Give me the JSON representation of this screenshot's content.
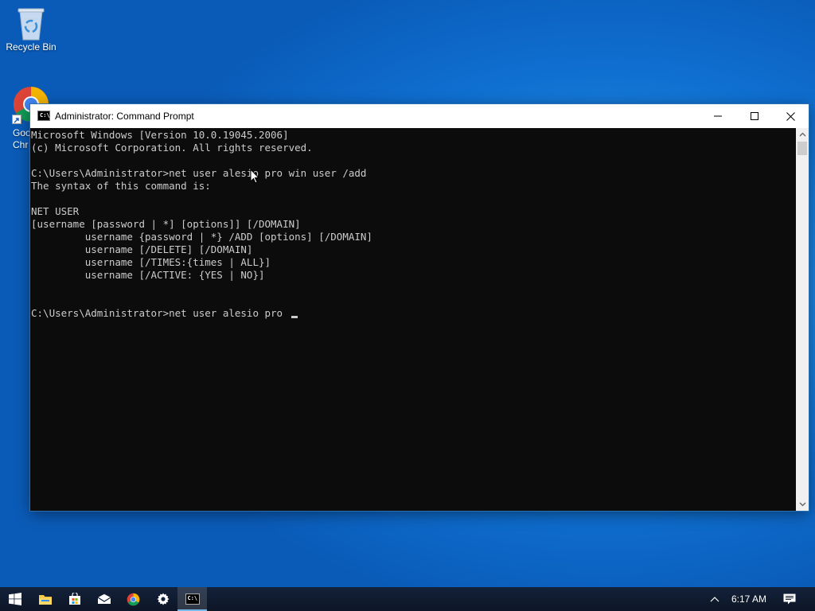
{
  "desktop": {
    "icons": [
      {
        "label": "Recycle Bin",
        "icon": "recycle-bin-icon"
      },
      {
        "label": "Goo\nChr",
        "icon": "chrome-shortcut-icon"
      }
    ]
  },
  "window": {
    "title": "Administrator: Command Prompt",
    "icon": "cmd-icon",
    "icon_text": "C:\\",
    "controls": [
      "minimize-icon",
      "maximize-icon",
      "close-icon"
    ]
  },
  "console": {
    "lines": [
      "Microsoft Windows [Version 10.0.19045.2006]",
      "(c) Microsoft Corporation. All rights reserved.",
      "",
      "C:\\Users\\Administrator>net user alesio pro win user /add",
      "The syntax of this command is:",
      "",
      "NET USER",
      "[username [password | *] [options]] [/DOMAIN]",
      "         username {password | *} /ADD [options] [/DOMAIN]",
      "         username [/DELETE] [/DOMAIN]",
      "         username [/TIMES:{times | ALL}]",
      "         username [/ACTIVE: {YES | NO}]",
      "",
      "",
      "C:\\Users\\Administrator>net user alesio pro "
    ]
  },
  "taskbar": {
    "items": [
      "windows-start-icon",
      "file-explorer-icon",
      "store-icon",
      "mail-icon",
      "chrome-icon",
      "settings-icon",
      "cmd-icon"
    ],
    "active": "cmd-icon",
    "clock": "6:17 AM",
    "tray": [
      "show-hidden-icons-icon",
      "notifications-icon"
    ]
  },
  "colors": {
    "console_bg": "#0c0c0c",
    "console_fg": "#cccccc",
    "desktop_blue": "#1e86e0",
    "taskbar": "#0f1a2c",
    "accent": "#76b9ed"
  }
}
